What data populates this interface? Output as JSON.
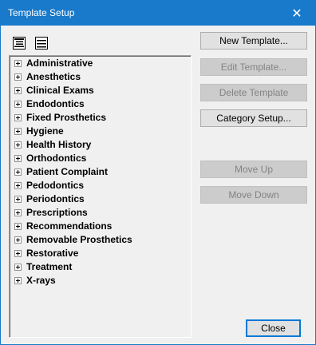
{
  "window": {
    "title": "Template Setup",
    "close_glyph": "✕"
  },
  "toolbar": {
    "expand_all_icon": "expand-all-icon",
    "collapse_all_icon": "collapse-all-icon"
  },
  "tree": {
    "items": [
      {
        "label": "Administrative"
      },
      {
        "label": "Anesthetics"
      },
      {
        "label": "Clinical Exams"
      },
      {
        "label": "Endodontics"
      },
      {
        "label": "Fixed Prosthetics"
      },
      {
        "label": "Hygiene"
      },
      {
        "label": "Health History"
      },
      {
        "label": "Orthodontics"
      },
      {
        "label": "Patient Complaint"
      },
      {
        "label": "Pedodontics"
      },
      {
        "label": "Periodontics"
      },
      {
        "label": "Prescriptions"
      },
      {
        "label": "Recommendations"
      },
      {
        "label": "Removable Prosthetics"
      },
      {
        "label": "Restorative"
      },
      {
        "label": "Treatment"
      },
      {
        "label": "X-rays"
      }
    ]
  },
  "buttons": {
    "new_template": "New Template...",
    "edit_template": "Edit Template...",
    "delete_template": "Delete Template",
    "category_setup": "Category Setup...",
    "move_up": "Move Up",
    "move_down": "Move Down",
    "close": "Close"
  },
  "colors": {
    "titlebar": "#1979ca",
    "disabled_text": "#838383"
  }
}
